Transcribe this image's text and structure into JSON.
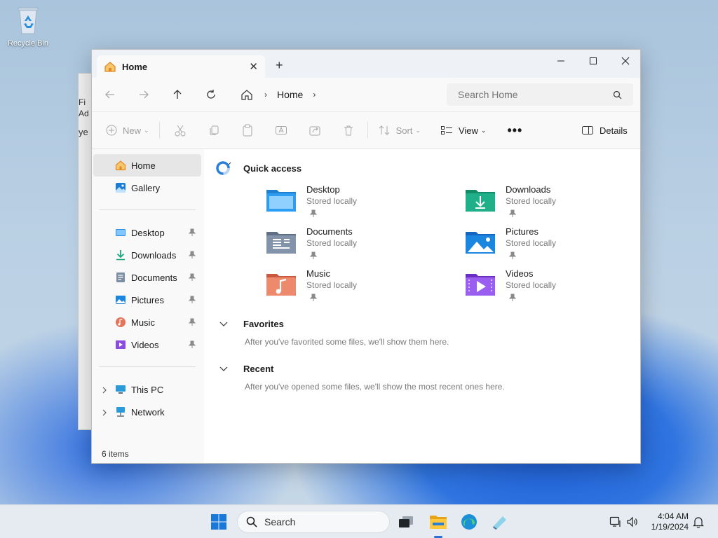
{
  "desktop": {
    "recycle_bin_label": "Recycle Bin"
  },
  "background_window": {
    "line1": "Fi",
    "line2": "Ad",
    "line3": "ye"
  },
  "window": {
    "tab_title": "Home",
    "breadcrumb": "Home",
    "search_placeholder": "Search Home",
    "toolbar": {
      "new_label": "New",
      "sort_label": "Sort",
      "view_label": "View",
      "details_label": "Details"
    },
    "sidebar": {
      "top": [
        {
          "label": "Home",
          "icon": "home-icon"
        },
        {
          "label": "Gallery",
          "icon": "gallery-icon"
        }
      ],
      "pinned": [
        {
          "label": "Desktop",
          "icon": "desktop-folder-icon"
        },
        {
          "label": "Downloads",
          "icon": "downloads-icon"
        },
        {
          "label": "Documents",
          "icon": "documents-icon"
        },
        {
          "label": "Pictures",
          "icon": "pictures-icon"
        },
        {
          "label": "Music",
          "icon": "music-icon"
        },
        {
          "label": "Videos",
          "icon": "videos-icon"
        }
      ],
      "drives": [
        {
          "label": "This PC",
          "icon": "computer-icon"
        },
        {
          "label": "Network",
          "icon": "network-icon"
        }
      ]
    },
    "quick_access": {
      "title": "Quick access",
      "items": [
        {
          "name": "Desktop",
          "sub": "Stored locally"
        },
        {
          "name": "Downloads",
          "sub": "Stored locally"
        },
        {
          "name": "Documents",
          "sub": "Stored locally"
        },
        {
          "name": "Pictures",
          "sub": "Stored locally"
        },
        {
          "name": "Music",
          "sub": "Stored locally"
        },
        {
          "name": "Videos",
          "sub": "Stored locally"
        }
      ]
    },
    "favorites": {
      "title": "Favorites",
      "empty": "After you've favorited some files, we'll show them here."
    },
    "recent": {
      "title": "Recent",
      "empty": "After you've opened some files, we'll show the most recent ones here."
    },
    "status": "6 items"
  },
  "taskbar": {
    "search_label": "Search",
    "time": "4:04 AM",
    "date": "1/19/2024"
  },
  "colors": {
    "accent": "#2a70d8",
    "window_chrome": "#eef1f5"
  }
}
